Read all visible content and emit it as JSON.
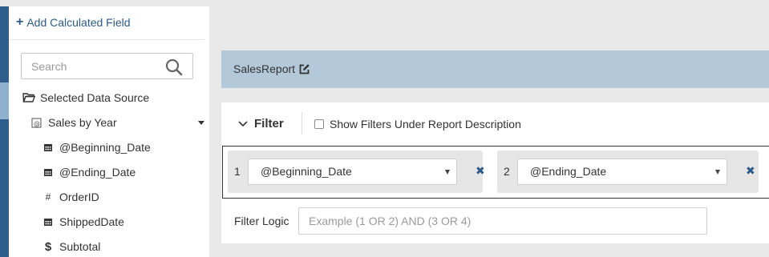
{
  "sidebar": {
    "add_calculated_field": "Add Calculated Field",
    "search": {
      "placeholder": "Search",
      "value": ""
    },
    "data_source_label": "Selected Data Source",
    "dataset": "Sales by Year",
    "fields": [
      {
        "name": "@Beginning_Date",
        "icon": "calendar-icon"
      },
      {
        "name": "@Ending_Date",
        "icon": "calendar-icon"
      },
      {
        "name": "OrderID",
        "icon": "hash-icon"
      },
      {
        "name": "ShippedDate",
        "icon": "calendar-icon"
      },
      {
        "name": "Subtotal",
        "icon": "dollar-icon"
      }
    ]
  },
  "report": {
    "name": "SalesReport"
  },
  "filter": {
    "title": "Filter",
    "show_filters_label": "Show Filters Under Report Description",
    "show_filters_checked": false,
    "items": [
      {
        "index": "1",
        "value": "@Beginning_Date"
      },
      {
        "index": "2",
        "value": "@Ending_Date"
      }
    ],
    "logic_label": "Filter Logic",
    "logic_placeholder": "Example (1 OR 2) AND (3 OR 4)",
    "logic_value": ""
  },
  "colors": {
    "accent": "#2c5b8a",
    "report_bar": "#b3c9d9",
    "rail": "#2f5d8c",
    "background": "#e9e9e9"
  }
}
